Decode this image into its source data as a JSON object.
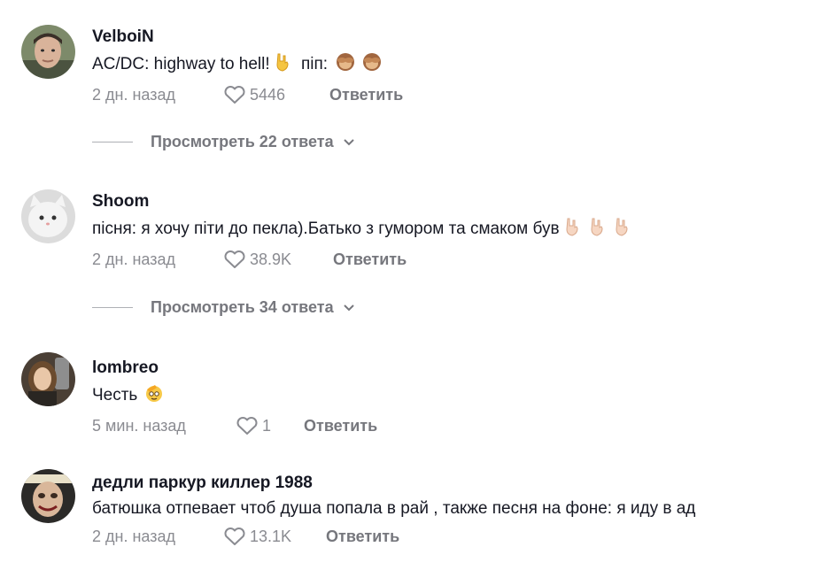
{
  "comments": [
    {
      "username": "VelboiN",
      "text": "AC/DC: highway to hell!",
      "text_suffix": "піп:",
      "date": "2 дн. назад",
      "likes": "5446",
      "reply_label": "Ответить",
      "view_replies": "Просмотреть 22 ответа",
      "emoji": [
        "rock-hand-emoji",
        "see-no-evil-monkey-emoji",
        "see-no-evil-monkey-emoji"
      ]
    },
    {
      "username": "Shoom",
      "text": "пісня: я хочу піти до пекла).Батько з гумором та смаком був",
      "date": "2 дн. назад",
      "likes": "38.9K",
      "reply_label": "Ответить",
      "view_replies": "Просмотреть 34 ответа",
      "emoji": [
        "rock-hand-light-emoji",
        "rock-hand-light-emoji",
        "rock-hand-light-emoji"
      ]
    },
    {
      "username": "lombreo",
      "text": "Честь",
      "date": "5 мин. назад",
      "likes": "1",
      "reply_label": "Ответить",
      "emoji": [
        "salute-face-emoji"
      ]
    },
    {
      "username": "дедли паркур киллер 1988",
      "text": "батюшка отпевает чтоб душа попала в рай , также песня на фоне: я иду в ад",
      "date": "2 дн. назад",
      "likes": "13.1K",
      "reply_label": "Ответить"
    }
  ],
  "colors": {
    "text": "#161823",
    "meta": "#8a8b91",
    "reply": "#76777d",
    "divider": "#aeb0b5"
  }
}
